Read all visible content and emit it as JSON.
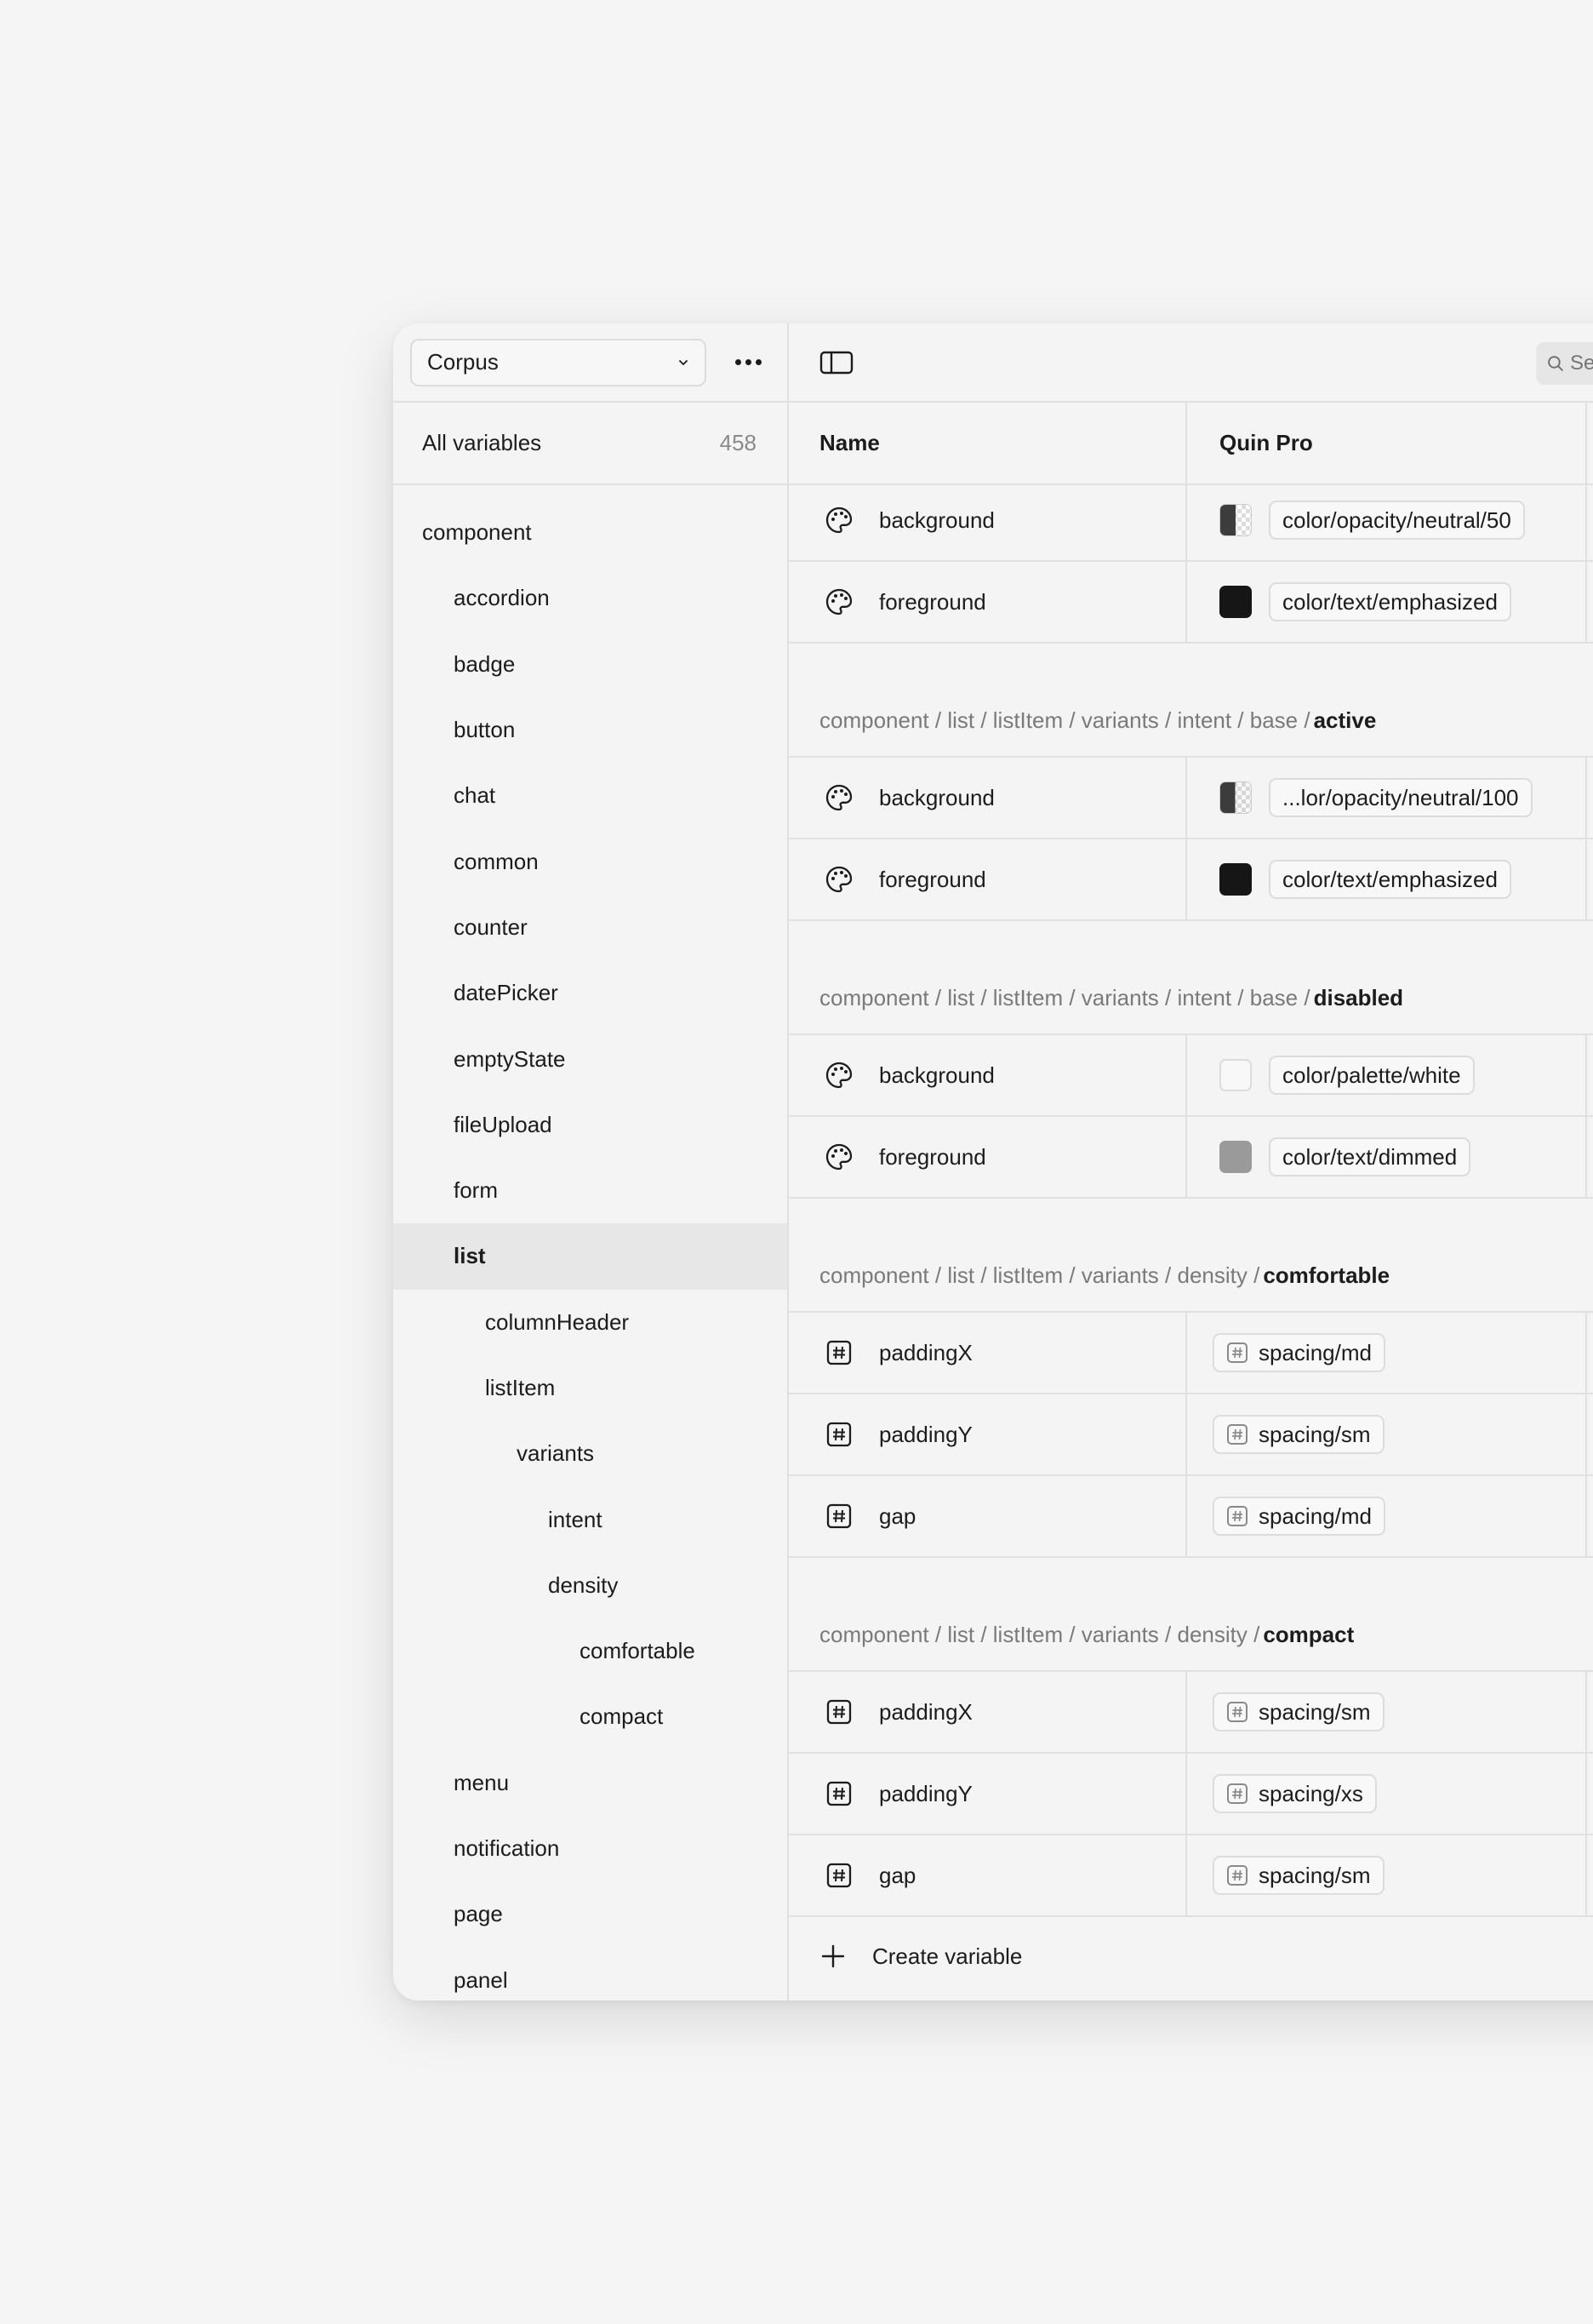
{
  "sidebar": {
    "collection": "Corpus",
    "all_variables_label": "All variables",
    "all_variables_count": "458",
    "tree": [
      {
        "label": "component",
        "depth": 0,
        "selected": false
      },
      {
        "label": "accordion",
        "depth": 1,
        "selected": false
      },
      {
        "label": "badge",
        "depth": 1,
        "selected": false
      },
      {
        "label": "button",
        "depth": 1,
        "selected": false
      },
      {
        "label": "chat",
        "depth": 1,
        "selected": false
      },
      {
        "label": "common",
        "depth": 1,
        "selected": false
      },
      {
        "label": "counter",
        "depth": 1,
        "selected": false
      },
      {
        "label": "datePicker",
        "depth": 1,
        "selected": false
      },
      {
        "label": "emptyState",
        "depth": 1,
        "selected": false
      },
      {
        "label": "fileUpload",
        "depth": 1,
        "selected": false
      },
      {
        "label": "form",
        "depth": 1,
        "selected": false
      },
      {
        "label": "list",
        "depth": 1,
        "selected": true
      },
      {
        "label": "columnHeader",
        "depth": 2,
        "selected": false
      },
      {
        "label": "listItem",
        "depth": 2,
        "selected": false
      },
      {
        "label": "variants",
        "depth": 3,
        "selected": false
      },
      {
        "label": "intent",
        "depth": 4,
        "selected": false
      },
      {
        "label": "density",
        "depth": 4,
        "selected": false
      },
      {
        "label": "comfortable",
        "depth": 5,
        "selected": false
      },
      {
        "label": "compact",
        "depth": 5,
        "selected": false
      },
      {
        "label": "menu",
        "depth": 1,
        "selected": false
      },
      {
        "label": "notification",
        "depth": 1,
        "selected": false
      },
      {
        "label": "page",
        "depth": 1,
        "selected": false
      },
      {
        "label": "panel",
        "depth": 1,
        "selected": false
      }
    ]
  },
  "toolbar": {
    "search_placeholder": "Search"
  },
  "table": {
    "columns": {
      "name": "Name",
      "mode": "Quin Pro"
    },
    "sections": [
      {
        "path": "",
        "leaf": "",
        "rows": [
          {
            "icon": "palette",
            "name": "background",
            "swatch": "checker",
            "value": "color/opacity/neutral/50"
          },
          {
            "icon": "palette",
            "name": "foreground",
            "swatch": "#161616",
            "value": "color/text/emphasized"
          }
        ]
      },
      {
        "path": "component / list / listItem / variants / intent / base /",
        "leaf": "active",
        "rows": [
          {
            "icon": "palette",
            "name": "background",
            "swatch": "checker-light",
            "value": "...lor/opacity/neutral/100"
          },
          {
            "icon": "palette",
            "name": "foreground",
            "swatch": "#161616",
            "value": "color/text/emphasized"
          }
        ]
      },
      {
        "path": "component / list / listItem / variants / intent / base /",
        "leaf": "disabled",
        "rows": [
          {
            "icon": "palette",
            "name": "background",
            "swatch": "#f8f8f8",
            "value": "color/palette/white"
          },
          {
            "icon": "palette",
            "name": "foreground",
            "swatch": "#9a9a9a",
            "value": "color/text/dimmed"
          }
        ]
      },
      {
        "path": "component / list / listItem / variants / density /",
        "leaf": "comfortable",
        "rows": [
          {
            "icon": "number",
            "name": "paddingX",
            "swatch": "",
            "value": "spacing/md"
          },
          {
            "icon": "number",
            "name": "paddingY",
            "swatch": "",
            "value": "spacing/sm"
          },
          {
            "icon": "number",
            "name": "gap",
            "swatch": "",
            "value": "spacing/md"
          }
        ]
      },
      {
        "path": "component / list / listItem / variants / density /",
        "leaf": "compact",
        "rows": [
          {
            "icon": "number",
            "name": "paddingX",
            "swatch": "",
            "value": "spacing/sm"
          },
          {
            "icon": "number",
            "name": "paddingY",
            "swatch": "",
            "value": "spacing/xs"
          },
          {
            "icon": "number",
            "name": "gap",
            "swatch": "",
            "value": "spacing/sm"
          }
        ]
      }
    ],
    "create_label": "Create variable"
  },
  "colors": {
    "background": "#f5f5f5",
    "panel": "#f4f4f4",
    "border": "#e0e0e0",
    "selected_row": "#e7e7e8",
    "text": "#1c1c1c",
    "muted_text": "#7a7a7a"
  }
}
